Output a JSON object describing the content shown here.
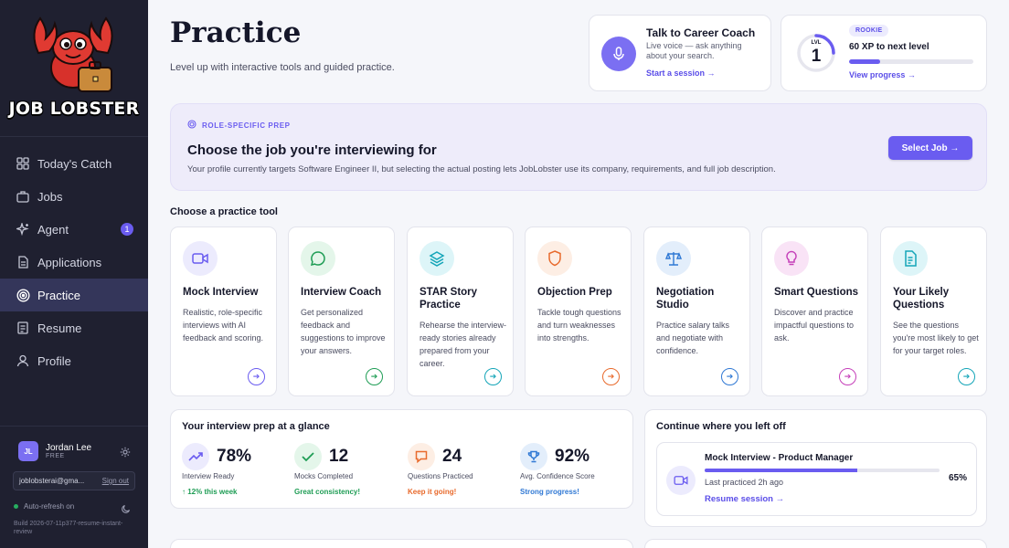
{
  "brand": {
    "name": "JOB LOBSTER"
  },
  "sidebar": {
    "items": [
      {
        "label": "Today's Catch",
        "icon": "grid-icon"
      },
      {
        "label": "Jobs",
        "icon": "briefcase-icon"
      },
      {
        "label": "Agent",
        "icon": "sparkle-icon",
        "badge": "1"
      },
      {
        "label": "Applications",
        "icon": "document-icon"
      },
      {
        "label": "Practice",
        "icon": "target-icon",
        "active": true
      },
      {
        "label": "Resume",
        "icon": "file-icon"
      },
      {
        "label": "Profile",
        "icon": "user-icon"
      }
    ],
    "user": {
      "initials": "JL",
      "name": "Jordan Lee",
      "plan": "FREE",
      "email": "joblobsterai@gma...",
      "signout": "Sign out"
    },
    "autorefresh": "Auto-refresh on",
    "build": "Build 2026-07-11p377-resume-instant-review"
  },
  "header": {
    "title": "Practice",
    "subtitle": "Level up with interactive tools and guided practice."
  },
  "coach": {
    "title": "Talk to Career Coach",
    "desc": "Live voice — ask anything about your search.",
    "link": "Start a session →"
  },
  "level": {
    "label": "LVL",
    "number": "1",
    "rank": "ROOKIE",
    "xp_text": "60 XP to next level",
    "progress": 0.25,
    "link": "View progress →"
  },
  "prep": {
    "tag": "ROLE-SPECIFIC PREP",
    "title": "Choose the job you're interviewing for",
    "desc": "Your profile currently targets Software Engineer II, but selecting the actual posting lets JobLobster use its company, requirements, and full job description.",
    "button": "Select Job →"
  },
  "tools_heading": "Choose a practice tool",
  "tools": [
    {
      "title": "Mock Interview",
      "desc": "Realistic, role-specific interviews with AI feedback and scoring.",
      "icon": "video-camera-icon",
      "color": "#6a5cf0",
      "bg": "#ecebfd"
    },
    {
      "title": "Interview Coach",
      "desc": "Get personalized feedback and suggestions to improve your answers.",
      "icon": "chat-bubble-icon",
      "color": "#1f9d55",
      "bg": "#e4f6ea"
    },
    {
      "title": "STAR Story Practice",
      "desc": "Rehearse the interview-ready stories already prepared from your career.",
      "icon": "layers-icon",
      "color": "#14a5b8",
      "bg": "#ddf5f8"
    },
    {
      "title": "Objection Prep",
      "desc": "Tackle tough questions and turn weaknesses into strengths.",
      "icon": "shield-icon",
      "color": "#e86a2c",
      "bg": "#fdeee4"
    },
    {
      "title": "Negotiation Studio",
      "desc": "Practice salary talks and negotiate with confidence.",
      "icon": "scales-icon",
      "color": "#2f78d4",
      "bg": "#e3eefb"
    },
    {
      "title": "Smart Questions",
      "desc": "Discover and practice impactful questions to ask.",
      "icon": "lightbulb-icon",
      "color": "#c53fb9",
      "bg": "#f9e3f6"
    },
    {
      "title": "Your Likely Questions",
      "desc": "See the questions you're most likely to get for your target roles.",
      "icon": "document-list-icon",
      "color": "#14a5b8",
      "bg": "#ddf5f8"
    }
  ],
  "glance": {
    "title": "Your interview prep at a glance",
    "stats": [
      {
        "value": "78%",
        "label": "Interview Ready",
        "note": "↑ 12% this week",
        "color": "#1f9d55",
        "icon": "trend-up-icon",
        "ic": "#6a5cf0",
        "bg": "#ecebfd"
      },
      {
        "value": "12",
        "label": "Mocks Completed",
        "note": "Great consistency!",
        "color": "#1f9d55",
        "icon": "check-icon",
        "ic": "#1f9d55",
        "bg": "#e4f6ea"
      },
      {
        "value": "24",
        "label": "Questions Practiced",
        "note": "Keep it going!",
        "color": "#e86a2c",
        "icon": "chat-icon",
        "ic": "#e86a2c",
        "bg": "#fdeee4"
      },
      {
        "value": "92%",
        "label": "Avg. Confidence Score",
        "note": "Strong progress!",
        "color": "#2f78d4",
        "icon": "trophy-icon",
        "ic": "#2f78d4",
        "bg": "#e3eefb"
      }
    ]
  },
  "continue": {
    "title": "Continue where you left off",
    "session": "Mock Interview - Product Manager",
    "last": "Last practiced 2h ago",
    "percent": "65%",
    "progress": 0.65,
    "link": "Resume session →"
  }
}
